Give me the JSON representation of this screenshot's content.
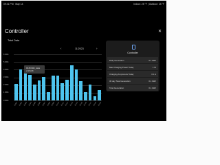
{
  "status_bar": {
    "time": "09:41 PM",
    "date": "May 14",
    "weather": "Indoor: 25 °F  |  Outdoor: 25 °F"
  },
  "page": {
    "title": "Controller",
    "close_label": "✕"
  },
  "chart": {
    "title": "Total Data",
    "date": "11/2023",
    "prev_label": "‹",
    "next_label": "›",
    "tooltip": {
      "line1": "03-05  kWh_value",
      "line2": "2.38 kWh"
    }
  },
  "chart_data": {
    "type": "bar",
    "categories": [
      "01",
      "02",
      "03",
      "04",
      "05",
      "06",
      "07",
      "08",
      "09",
      "10",
      "11",
      "12",
      "13",
      "14",
      "15",
      "16",
      "17",
      "18",
      "19"
    ],
    "values": [
      2.15,
      4.05,
      3.85,
      3.3,
      2.1,
      2.6,
      3.05,
      1.05,
      3.25,
      3.2,
      2.25,
      2.7,
      4.6,
      4.0,
      2.55,
      1.1,
      2.05,
      0.55,
      1.35
    ],
    "ylim": [
      0,
      6
    ],
    "y_ticks": [
      "0 kWh",
      "1 kWh",
      "2 kWh",
      "3 kWh",
      "4 kWh",
      "5 kWh",
      "6 kWh"
    ],
    "x_tick_labels": [
      "11-01",
      "11-02",
      "11-03",
      "11-04",
      "11-05",
      "11-06",
      "11-07",
      "11-08",
      "11-09",
      "11-10",
      "11-11",
      "11-12",
      "11-13",
      "11-14",
      "11-15",
      "11-16",
      "11-17",
      "11-18",
      "11-19"
    ],
    "color": "#4ec4ee",
    "grid": true
  },
  "panel": {
    "title": "Controller",
    "icon": "phone-icon",
    "rows": [
      {
        "label": "Daily Generation",
        "value": "0.1 kWh"
      },
      {
        "label": "Max Charging Power Today",
        "value": "1 W"
      },
      {
        "label": "Charging Amp-Hours Today",
        "value": "0.1 A"
      },
      {
        "label": "30 day Total Generation",
        "value": "0.1 kWh"
      },
      {
        "label": "Total Generation",
        "value": "0.1 kWh"
      }
    ]
  }
}
